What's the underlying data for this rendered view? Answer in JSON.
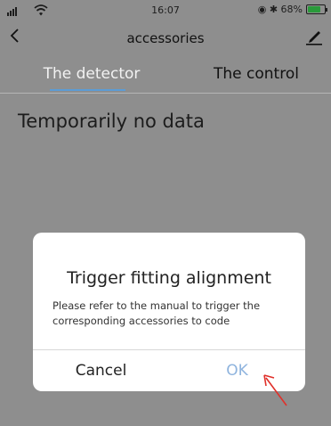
{
  "statusbar": {
    "time": "16:07",
    "battery_text": "◉ ✱ 68%",
    "battery_level": 0.68,
    "battery_color": "#2a9a3b"
  },
  "navbar": {
    "title": "accessories",
    "back_icon": "chevron-left-icon",
    "edit_icon": "edit-icon"
  },
  "tabs": [
    {
      "label": "The detector",
      "active": true
    },
    {
      "label": "The control",
      "active": false
    }
  ],
  "accent_color": "#5b9cd6",
  "content": {
    "empty_text": "Temporarily no data"
  },
  "dialog": {
    "title": "Trigger fitting alignment",
    "message": "Please refer to the manual to trigger the corresponding accessories to code",
    "cancel_label": "Cancel",
    "ok_label": "OK"
  },
  "annotation": {
    "arrow_color": "#e0302a"
  }
}
